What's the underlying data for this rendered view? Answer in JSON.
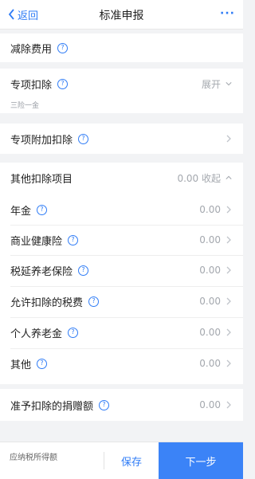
{
  "nav": {
    "back_label": "返回",
    "title": "标准申报",
    "more": "···"
  },
  "sections": {
    "reduce_fees": {
      "label": "减除费用"
    },
    "special": {
      "label": "专项扣除",
      "right_text": "展开",
      "sub": "三险一金"
    },
    "special_additional": {
      "label": "专项附加扣除"
    },
    "other": {
      "label": "其他扣除项目",
      "right_text": "0.00 收起",
      "items": [
        {
          "label": "年金",
          "value": "0.00"
        },
        {
          "label": "商业健康险",
          "value": "0.00"
        },
        {
          "label": "税延养老保险",
          "value": "0.00"
        },
        {
          "label": "允许扣除的税费",
          "value": "0.00"
        },
        {
          "label": "个人养老金",
          "value": "0.00"
        },
        {
          "label": "其他",
          "value": "0.00"
        }
      ]
    },
    "donation": {
      "label": "准予扣除的捐赠额",
      "value": "0.00"
    }
  },
  "bottom": {
    "tax_label": "应纳税所得额",
    "save_label": "保存",
    "next_label": "下一步"
  },
  "colors": {
    "accent": "#2f7cf6",
    "primary_button": "#3b83f7",
    "background": "#f2f3f5"
  }
}
